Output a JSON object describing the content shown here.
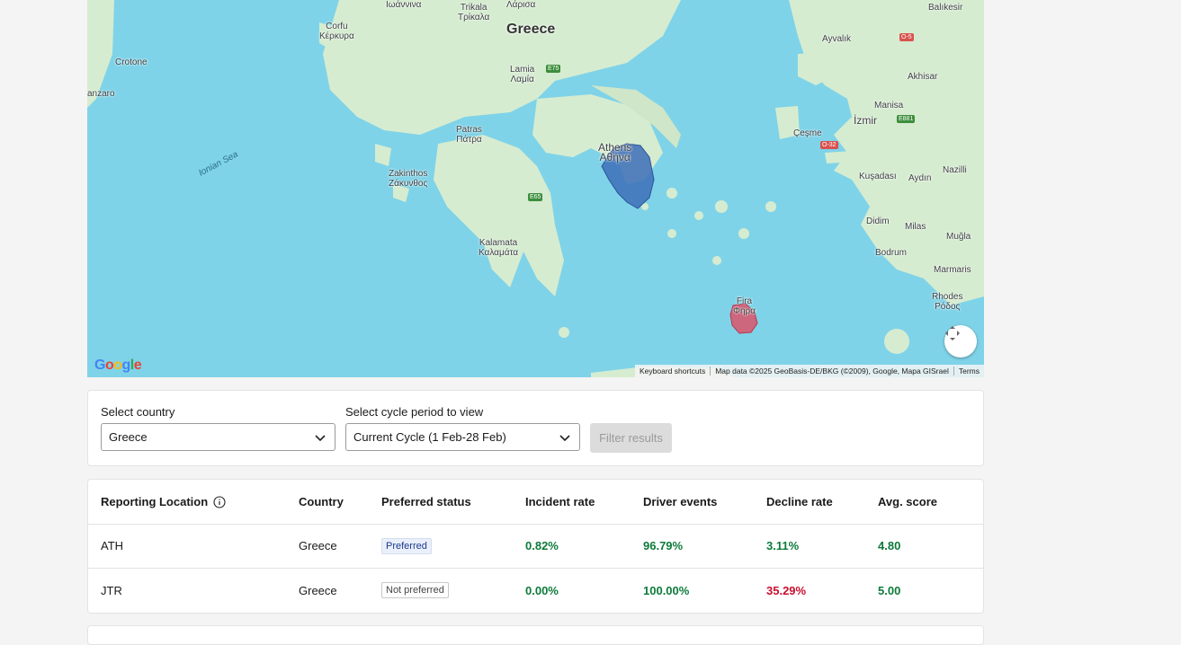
{
  "map": {
    "labels": {
      "greece": "Greece",
      "ioannina": "Ιωάννινα",
      "trikala": "Trikala\nΤρίκαλα",
      "larisa": "Λάρισα",
      "corfu": "Corfu\nΚέρκυρα",
      "crotone": "Crotone",
      "anzaro": "anzaro",
      "lamia": "Lamia\nΛαμία",
      "patras": "Patras\nΠάτρα",
      "athens": "Athens\nΑθήνα",
      "zakinthos": "Zakinthos\nΖάκυνθος",
      "kalamata": "Kalamata\nΚαλαμάτα",
      "ionian_sea": "Ionian Sea",
      "fira": "Fira\nΦηρα",
      "balikesir": "Balıkesir",
      "ayvalik": "Ayvalık",
      "akhisar": "Akhisar",
      "manisa": "Manisa",
      "izmir": "İzmir",
      "cesme": "Çeşme",
      "kusadasi": "Kuşadası",
      "aydin": "Aydın",
      "nazilli": "Nazilli",
      "didim": "Didim",
      "milas": "Milas",
      "mugla": "Muğla",
      "bodrum": "Bodrum",
      "marmaris": "Marmaris",
      "rhodes": "Rhodes\nΡόδος"
    },
    "roads": {
      "e75": "E75",
      "e65": "E65",
      "e881": "E881",
      "o32": "O-32",
      "o5": "O-5"
    },
    "google_logo": "Google",
    "attribution": {
      "shortcuts": "Keyboard shortcuts",
      "data": "Map data ©2025 GeoBasis-DE/BKG (©2009), Google, Mapa GISrael",
      "terms": "Terms"
    },
    "colors": {
      "sea": "#7fd3e8",
      "land": "#d6ecd0",
      "athens_zone": "#3d6fb8",
      "fira_zone": "#d9536a"
    }
  },
  "filters": {
    "country_label": "Select country",
    "country_value": "Greece",
    "cycle_label": "Select cycle period to view",
    "cycle_value": "Current Cycle (1 Feb-28 Feb)",
    "filter_button": "Filter results"
  },
  "table": {
    "headers": {
      "location": "Reporting Location",
      "country": "Country",
      "preferred": "Preferred status",
      "incident": "Incident rate",
      "driver": "Driver events",
      "decline": "Decline rate",
      "score": "Avg. score"
    },
    "rows": [
      {
        "location": "ATH",
        "country": "Greece",
        "preferred": "Preferred",
        "incident": "0.82%",
        "driver": "96.79%",
        "decline": "3.11%",
        "score": "4.80"
      },
      {
        "location": "JTR",
        "country": "Greece",
        "preferred": "Not preferred",
        "incident": "0.00%",
        "driver": "100.00%",
        "decline": "35.29%",
        "score": "5.00"
      }
    ]
  }
}
